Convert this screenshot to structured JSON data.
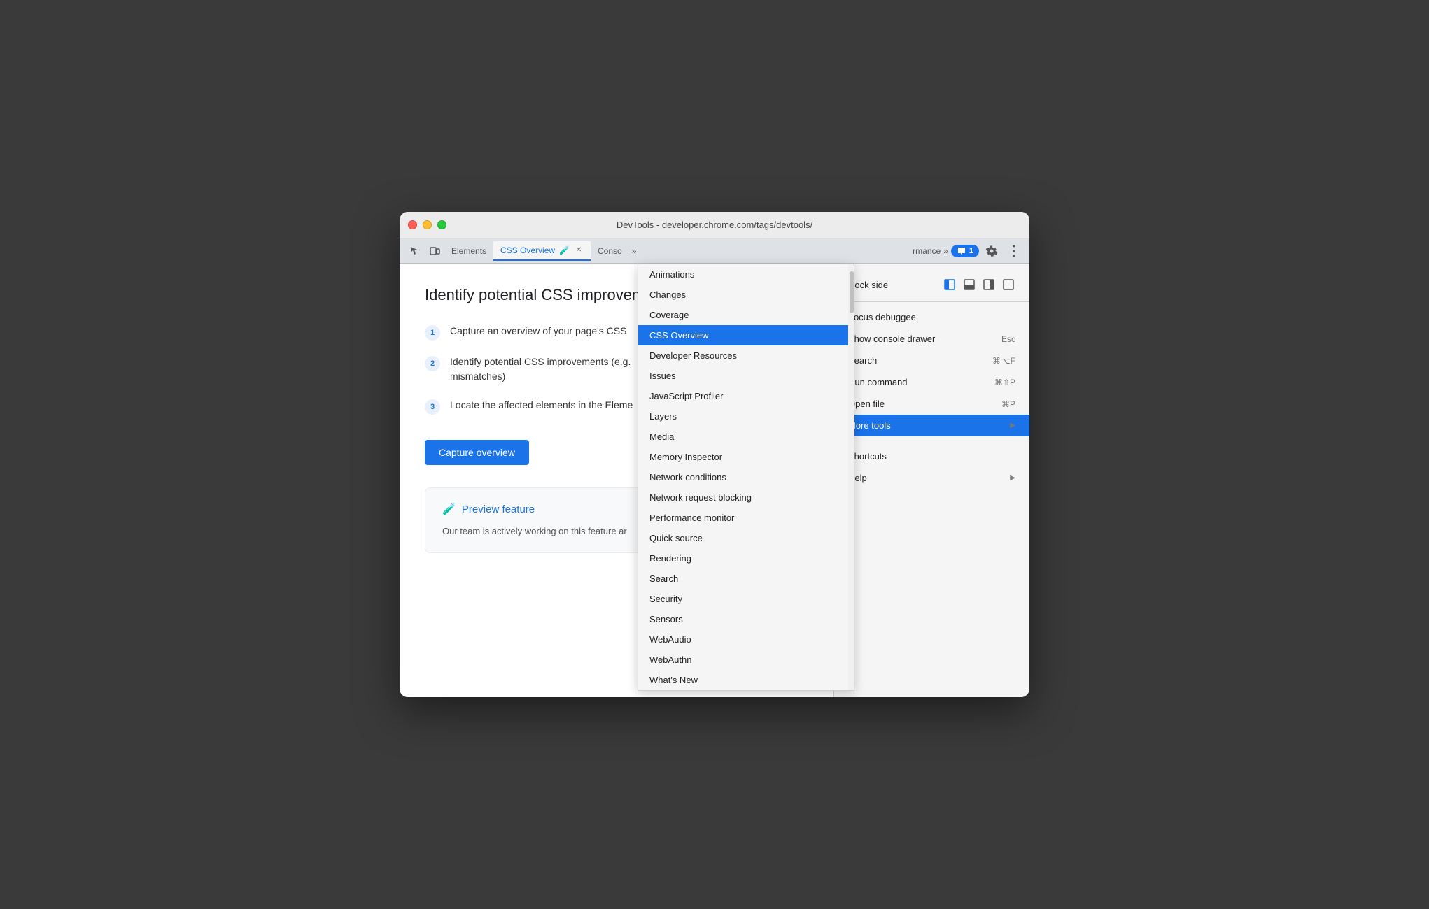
{
  "window": {
    "title": "DevTools - developer.chrome.com/tags/devtools/"
  },
  "tabs": [
    {
      "id": "tab-elements",
      "label": "Elements",
      "active": false
    },
    {
      "id": "tab-css-overview",
      "label": "CSS Overview",
      "active": true,
      "has_icon": true,
      "closeable": true
    },
    {
      "id": "tab-console",
      "label": "Conso",
      "active": false,
      "truncated": true
    }
  ],
  "tab_bar": {
    "more_label": "»",
    "badge_count": "1"
  },
  "main_content": {
    "heading": "Identify potential CSS improvemer",
    "steps": [
      {
        "num": "1",
        "text": "Capture an overview of your page's CSS"
      },
      {
        "num": "2",
        "text": "Identify potential CSS improvements (e.g.\nmismatches)"
      },
      {
        "num": "3",
        "text": "Locate the affected elements in the Eleme"
      }
    ],
    "capture_btn": "Capture overview",
    "preview": {
      "title": "Preview feature",
      "icon": "🧪",
      "text": "Our team is actively working on this feature ar"
    }
  },
  "dropdown": {
    "items": [
      {
        "id": "animations",
        "label": "Animations",
        "selected": false
      },
      {
        "id": "changes",
        "label": "Changes",
        "selected": false
      },
      {
        "id": "coverage",
        "label": "Coverage",
        "selected": false
      },
      {
        "id": "css-overview",
        "label": "CSS Overview",
        "selected": true
      },
      {
        "id": "developer-resources",
        "label": "Developer Resources",
        "selected": false
      },
      {
        "id": "issues",
        "label": "Issues",
        "selected": false
      },
      {
        "id": "javascript-profiler",
        "label": "JavaScript Profiler",
        "selected": false
      },
      {
        "id": "layers",
        "label": "Layers",
        "selected": false
      },
      {
        "id": "media",
        "label": "Media",
        "selected": false
      },
      {
        "id": "memory-inspector",
        "label": "Memory Inspector",
        "selected": false
      },
      {
        "id": "network-conditions",
        "label": "Network conditions",
        "selected": false
      },
      {
        "id": "network-request-blocking",
        "label": "Network request blocking",
        "selected": false
      },
      {
        "id": "performance-monitor",
        "label": "Performance monitor",
        "selected": false
      },
      {
        "id": "quick-source",
        "label": "Quick source",
        "selected": false
      },
      {
        "id": "rendering",
        "label": "Rendering",
        "selected": false
      },
      {
        "id": "search",
        "label": "Search",
        "selected": false
      },
      {
        "id": "security",
        "label": "Security",
        "selected": false
      },
      {
        "id": "sensors",
        "label": "Sensors",
        "selected": false
      },
      {
        "id": "webaudio",
        "label": "WebAudio",
        "selected": false
      },
      {
        "id": "webauthn",
        "label": "WebAuthn",
        "selected": false
      },
      {
        "id": "whats-new",
        "label": "What's New",
        "selected": false
      }
    ]
  },
  "right_panel": {
    "dock_side_label": "Dock side",
    "items": [
      {
        "id": "focus-debuggee",
        "label": "Focus debuggee",
        "shortcut": "",
        "has_arrow": false
      },
      {
        "id": "show-console-drawer",
        "label": "Show console drawer",
        "shortcut": "Esc",
        "has_arrow": false
      },
      {
        "id": "search",
        "label": "Search",
        "shortcut": "⌘⌥F",
        "has_arrow": false
      },
      {
        "id": "run-command",
        "label": "Run command",
        "shortcut": "⌘⇧P",
        "has_arrow": false
      },
      {
        "id": "open-file",
        "label": "Open file",
        "shortcut": "⌘P",
        "has_arrow": false
      },
      {
        "id": "more-tools",
        "label": "More tools",
        "shortcut": "",
        "has_arrow": true,
        "selected": true
      },
      {
        "id": "shortcuts",
        "label": "Shortcuts",
        "shortcut": "",
        "has_arrow": false
      },
      {
        "id": "help",
        "label": "Help",
        "shortcut": "",
        "has_arrow": true
      }
    ]
  }
}
